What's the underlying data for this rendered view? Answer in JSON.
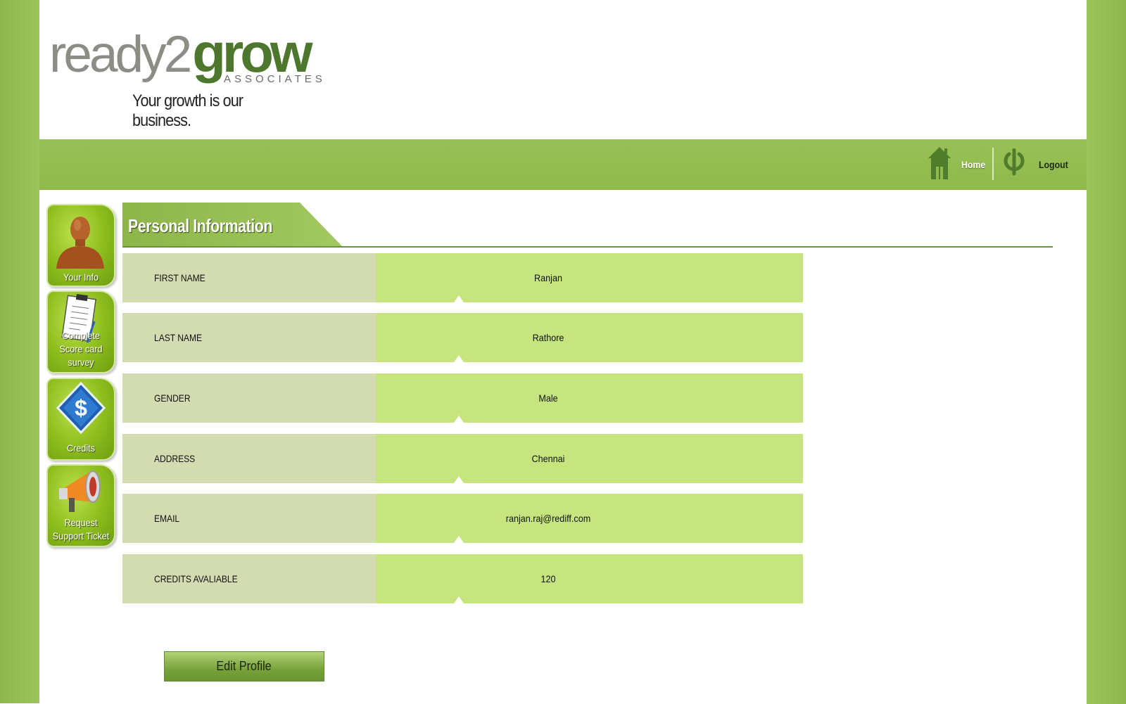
{
  "brand": {
    "logo_ready": "ready2",
    "logo_grow": "grow",
    "logo_associates": "ASSOCIATES",
    "tagline": "Your growth is our business."
  },
  "nav": {
    "home_label": "Home",
    "logout_label": "Logout",
    "home_icon": "house-icon",
    "logout_icon": "power-icon"
  },
  "sidebar": {
    "items": [
      {
        "label": "Your Info",
        "icon": "person-icon"
      },
      {
        "label": "Complete Score card survey",
        "icon": "clipboard-icon"
      },
      {
        "label": "Credits",
        "icon": "dollar-icon"
      },
      {
        "label": "Request Support Ticket",
        "icon": "megaphone-icon"
      }
    ]
  },
  "section": {
    "title": "Personal Information"
  },
  "profile": {
    "rows": [
      {
        "label": "FIRST NAME",
        "value": "Ranjan"
      },
      {
        "label": "LAST NAME",
        "value": "Rathore"
      },
      {
        "label": "GENDER",
        "value": "Male"
      },
      {
        "label": "ADDRESS",
        "value": "Chennai"
      },
      {
        "label": "EMAIL",
        "value": "ranjan.raj@rediff.com"
      },
      {
        "label": "CREDITS AVALIABLE",
        "value": "120"
      }
    ]
  },
  "actions": {
    "edit_label": "Edit Profile"
  },
  "colors": {
    "brand_green": "#95bd55",
    "label_cell": "#d2dcb0",
    "value_cell": "#c6e57f",
    "logo_green": "#4c772c"
  }
}
